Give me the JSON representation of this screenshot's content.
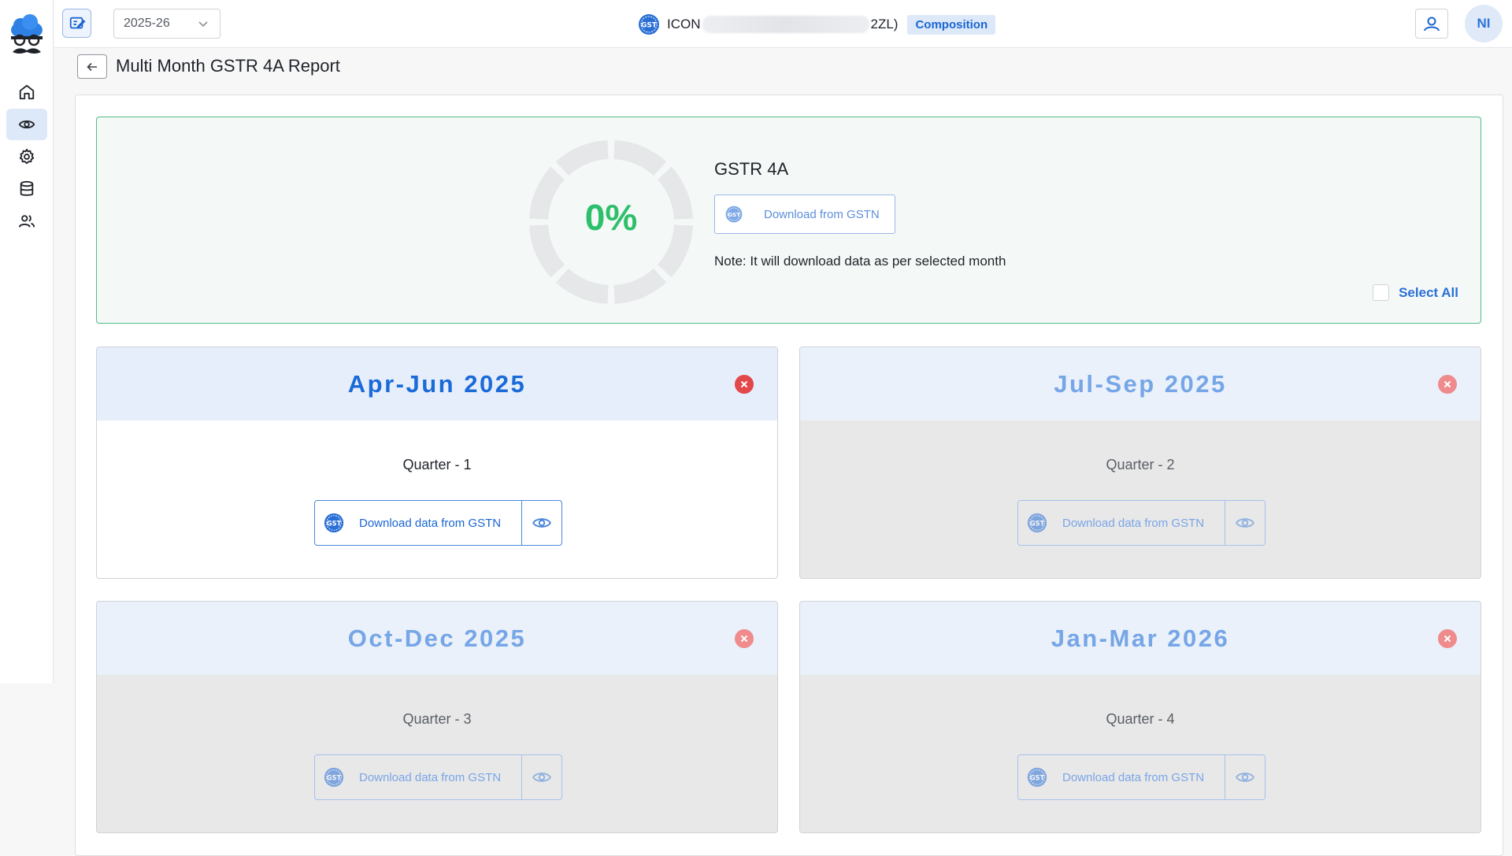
{
  "header": {
    "financial_year": "2025-26",
    "company_name_prefix": "ICON",
    "company_name_suffix": "2ZL)",
    "company_badge": "Composition",
    "user_initials": "NI"
  },
  "sidebar": {
    "items": [
      {
        "name": "home",
        "icon": "home-icon"
      },
      {
        "name": "view",
        "icon": "eye-icon",
        "active": true
      },
      {
        "name": "settings",
        "icon": "gear-icon"
      },
      {
        "name": "database",
        "icon": "database-icon"
      },
      {
        "name": "users",
        "icon": "users-icon"
      }
    ]
  },
  "page": {
    "title": "Multi Month GSTR 4A Report"
  },
  "summary": {
    "progress_percent": 0,
    "progress_label": "0%",
    "title": "GSTR 4A",
    "download_label": "Download from GSTN",
    "note": "Note: It will download data as per selected month",
    "select_all_label": "Select All"
  },
  "quarters": [
    {
      "period": "Apr-Jun 2025",
      "label": "Quarter - 1",
      "download_label": "Download data from GSTN",
      "active": true
    },
    {
      "period": "Jul-Sep 2025",
      "label": "Quarter - 2",
      "download_label": "Download data from GSTN",
      "active": false
    },
    {
      "period": "Oct-Dec 2025",
      "label": "Quarter - 3",
      "download_label": "Download data from GSTN",
      "active": false
    },
    {
      "period": "Jan-Mar 2026",
      "label": "Quarter - 4",
      "download_label": "Download data from GSTN",
      "active": false
    }
  ],
  "colors": {
    "brand_blue": "#1a66d2",
    "success_green": "#2dbf6a",
    "summary_border": "#55bb85",
    "close_red": "#e2474a"
  }
}
